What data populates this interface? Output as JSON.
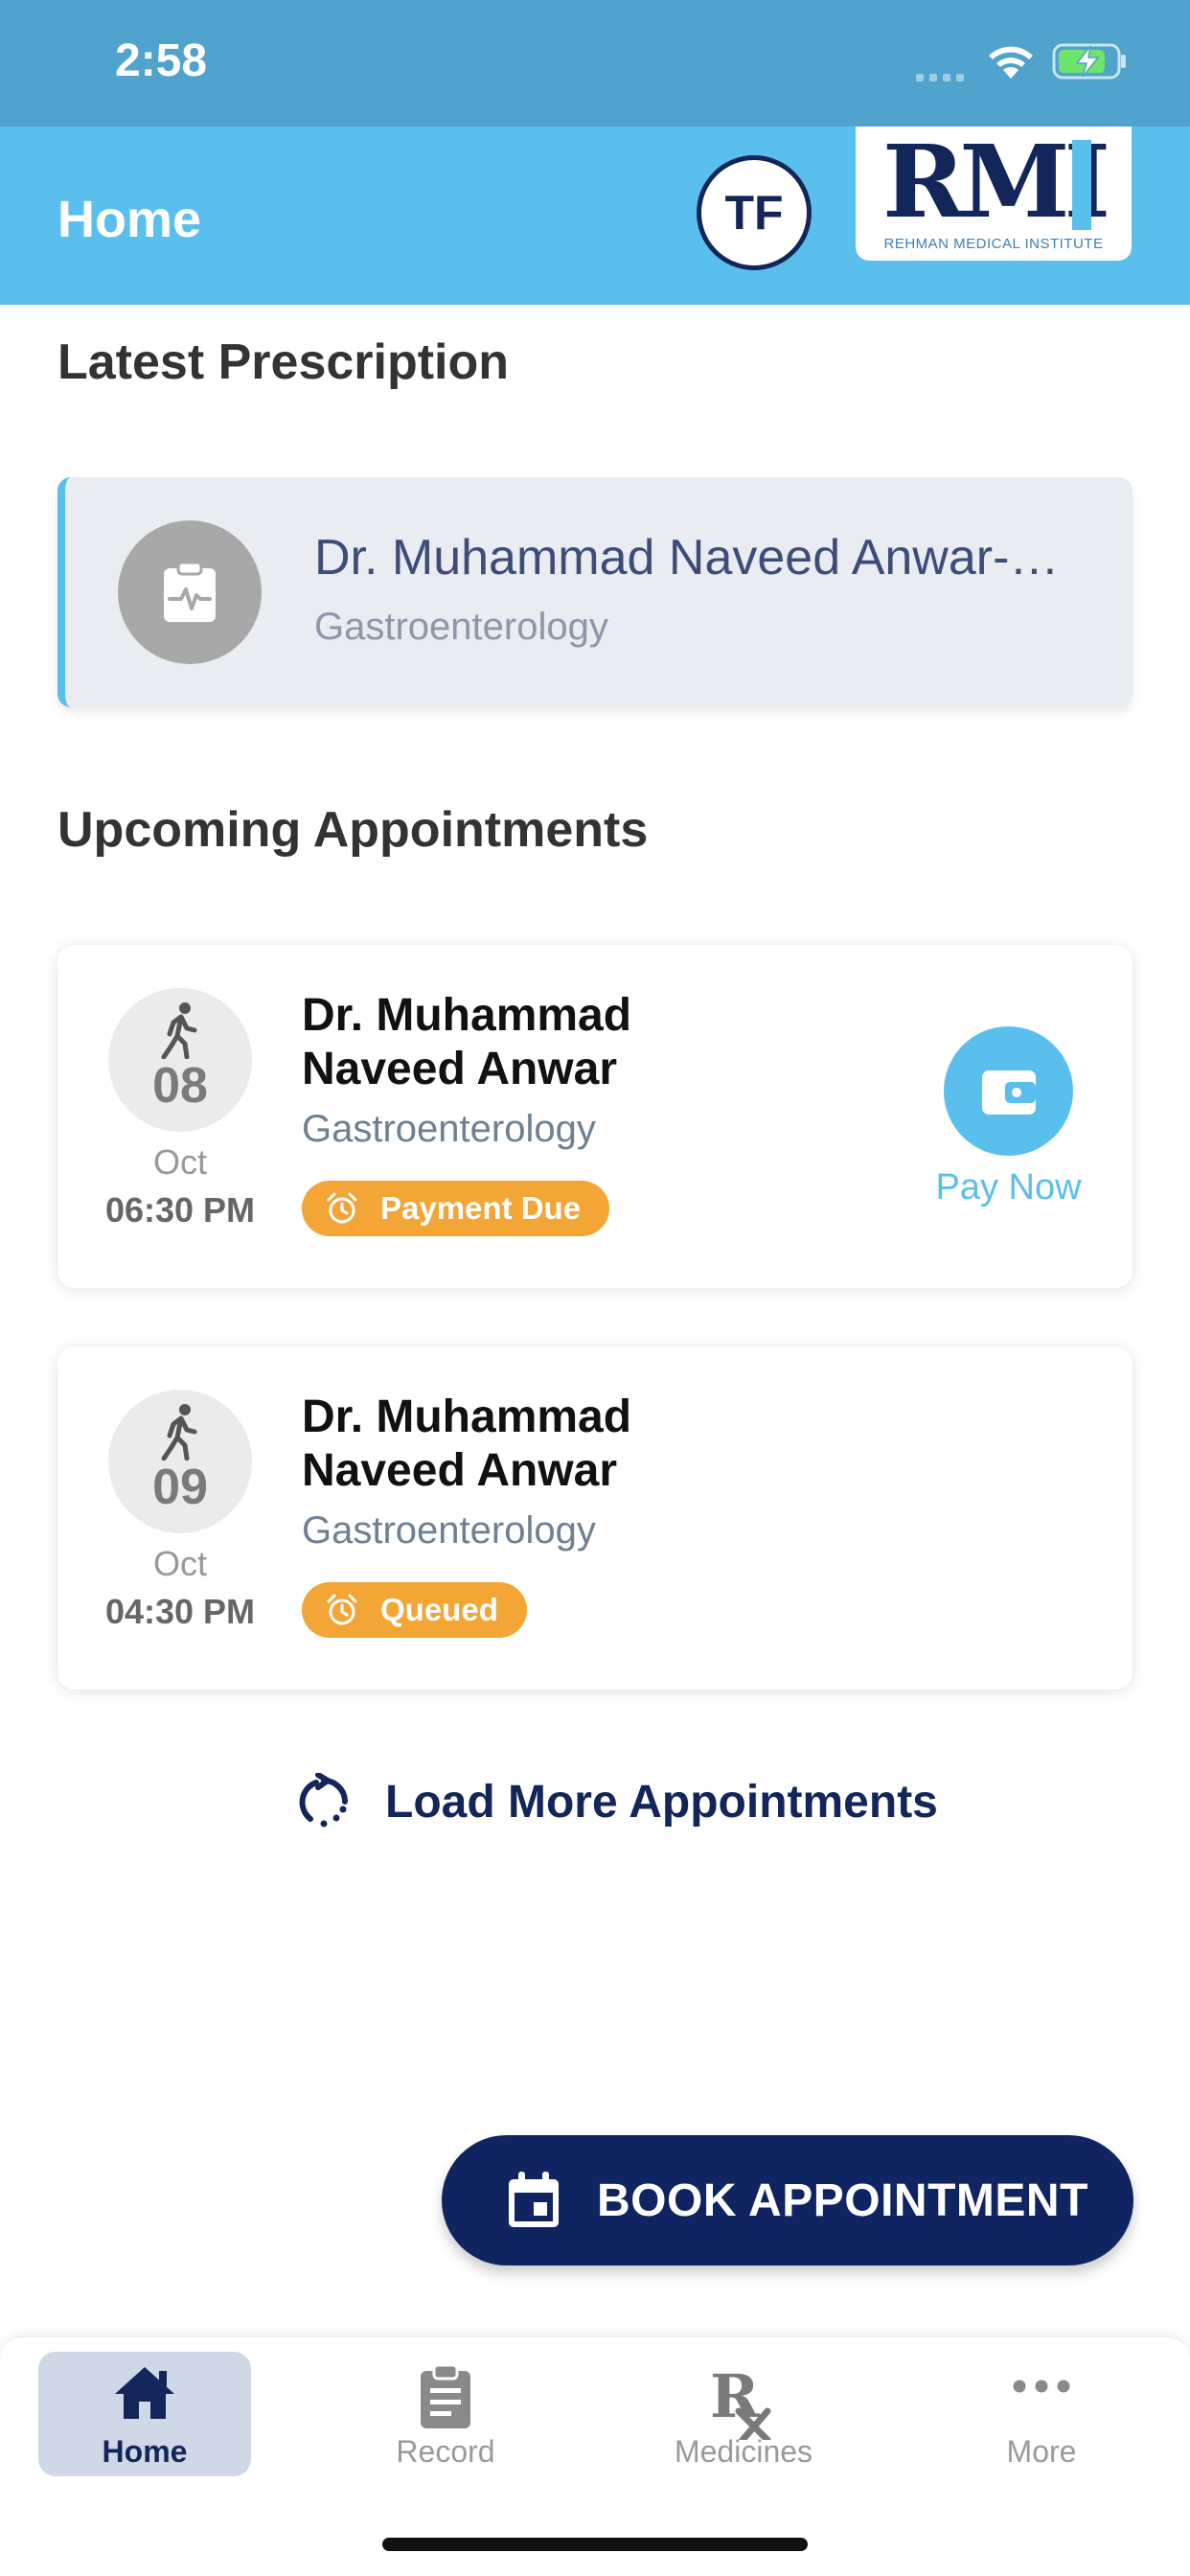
{
  "status_bar": {
    "time": "2:58"
  },
  "header": {
    "title": "Home",
    "avatar_initials": "TF",
    "logo_text": "RMI",
    "logo_subtitle": "REHMAN MEDICAL INSTITUTE"
  },
  "latest_prescription": {
    "heading": "Latest Prescription",
    "doctor": "Dr. Muhammad Naveed Anwar-…",
    "specialty": "Gastroenterology"
  },
  "upcoming": {
    "heading": "Upcoming Appointments",
    "appointments": [
      {
        "day": "08",
        "month": "Oct",
        "time": "06:30 PM",
        "doctor": "Dr. Muhammad Naveed Anwar",
        "specialty": "Gastroenterology",
        "status": "Payment Due",
        "action": "Pay Now"
      },
      {
        "day": "09",
        "month": "Oct",
        "time": "04:30 PM",
        "doctor": "Dr. Muhammad Naveed Anwar",
        "specialty": "Gastroenterology",
        "status": "Queued"
      }
    ],
    "load_more": "Load More Appointments"
  },
  "book_button": "BOOK APPOINTMENT",
  "tabs": [
    {
      "label": "Home",
      "icon": "home-icon",
      "active": true
    },
    {
      "label": "Record",
      "icon": "clipboard-icon",
      "active": false
    },
    {
      "label": "Medicines",
      "icon": "rx-icon",
      "active": false
    },
    {
      "label": "More",
      "icon": "more-icon",
      "active": false
    }
  ],
  "colors": {
    "status_bar": "#4fa3cc",
    "header": "#5bbfee",
    "navy": "#13265a",
    "badge_orange": "#f3a536",
    "button_navy": "#0f2460"
  }
}
